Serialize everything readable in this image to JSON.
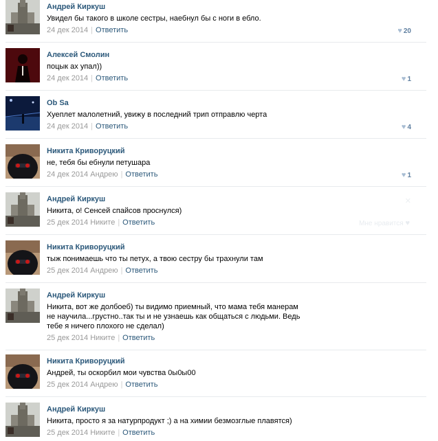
{
  "comments": [
    {
      "author": "Андрей Киркуш",
      "avatar": "tower-avatar",
      "text": "Увидел бы такого в школе сестры, наебнул бы с ноги в ебло.",
      "date": "24 дек 2014",
      "reply_to": "",
      "reply_label": "Ответить",
      "likes": "20"
    },
    {
      "author": "Алексей Смолин",
      "avatar": "suit-avatar",
      "text": "поцык ах упал))",
      "date": "24 дек 2014",
      "reply_to": "",
      "reply_label": "Ответить",
      "likes": "1"
    },
    {
      "author": "Ob Sa",
      "avatar": "night-avatar",
      "text": "Хуеплет малолетний, увижу в последний трип отправлю черта",
      "date": "24 дек 2014",
      "reply_to": "",
      "reply_label": "Ответить",
      "likes": "4"
    },
    {
      "author": "Никита Криворуцкий",
      "avatar": "hood-avatar",
      "text": "не, тебя бы ебнули петушара",
      "date": "24 дек 2014",
      "reply_to": "Андрею",
      "reply_label": "Ответить",
      "likes": "1"
    },
    {
      "author": "Андрей Киркуш",
      "avatar": "tower-avatar",
      "text": "Никита, о! Сенсей спайсов проснулся)",
      "date": "25 дек 2014",
      "reply_to": "Никите",
      "reply_label": "Ответить",
      "likes": "",
      "hover_like": "Мне нравится"
    },
    {
      "author": "Никита Криворуцкий",
      "avatar": "hood-avatar",
      "text": "тыж понимаешь что ты петух, а твою сестру бы трахнули там",
      "date": "25 дек 2014",
      "reply_to": "Андрею",
      "reply_label": "Ответить",
      "likes": ""
    },
    {
      "author": "Андрей Киркуш",
      "avatar": "tower-avatar",
      "text": "Никита, вот же долбоеб) ты видимо приемный, что мама тебя манерам не научила...грустно..так ты и не узнаешь как общаться с людьми. Ведь тебе я ничего плохого не сделал)",
      "date": "25 дек 2014",
      "reply_to": "Никите",
      "reply_label": "Ответить",
      "likes": ""
    },
    {
      "author": "Никита Криворуцкий",
      "avatar": "hood-avatar",
      "text": "Андрей, ты оскорбил мои чувства 0ы0ы00",
      "date": "25 дек 2014",
      "reply_to": "Андрею",
      "reply_label": "Ответить",
      "likes": ""
    },
    {
      "author": "Андрей Киркуш",
      "avatar": "tower-avatar",
      "text": "Никита, просто я за натурпродукт ;) а на химии безмозглые плавятся)",
      "date": "25 дек 2014",
      "reply_to": "Никите",
      "reply_label": "Ответить",
      "likes": ""
    }
  ],
  "colors": {
    "link": "#2b587a",
    "meta": "#999999",
    "divider": "#e7eaed"
  }
}
